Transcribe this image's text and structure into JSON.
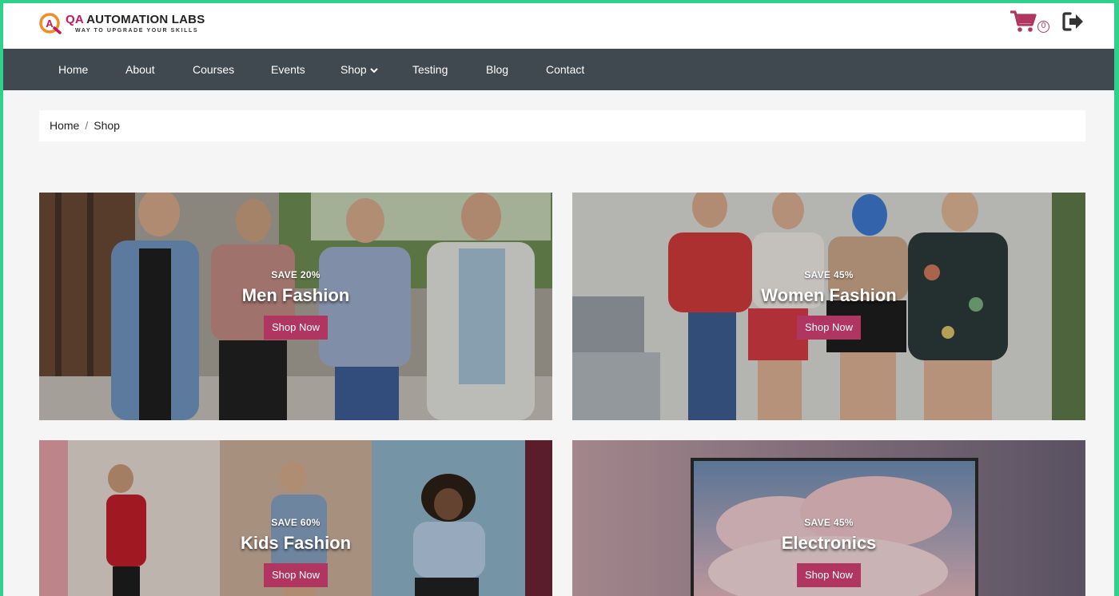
{
  "brand": {
    "title_prefix": "QA",
    "title_rest": " AUTOMATION LABS",
    "tagline": "WAY TO UPGRADE YOUR SKILLS",
    "accent": "#c2185b"
  },
  "header": {
    "cart_count": "0",
    "cart_icon": "shopping-cart-icon",
    "logout_icon": "sign-out-icon"
  },
  "nav": {
    "items": [
      {
        "label": "Home"
      },
      {
        "label": "About"
      },
      {
        "label": "Courses"
      },
      {
        "label": "Events"
      },
      {
        "label": "Shop"
      },
      {
        "label": "Testing"
      },
      {
        "label": "Blog"
      },
      {
        "label": "Contact"
      }
    ],
    "background": "#404850"
  },
  "breadcrumb": {
    "home": "Home",
    "separator": "/",
    "current": "Shop"
  },
  "categories": [
    {
      "save": "SAVE 20%",
      "title": "Men Fashion",
      "button": "Shop Now"
    },
    {
      "save": "SAVE 45%",
      "title": "Women Fashion",
      "button": "Shop Now"
    },
    {
      "save": "SAVE 60%",
      "title": "Kids Fashion",
      "button": "Shop Now"
    },
    {
      "save": "SAVE 45%",
      "title": "Electronics",
      "button": "Shop Now"
    }
  ],
  "button_color": "#b03560"
}
